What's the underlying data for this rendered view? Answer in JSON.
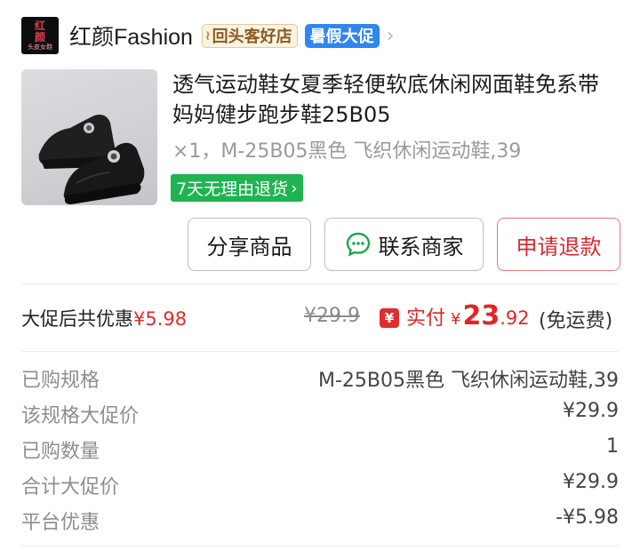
{
  "shop": {
    "logo_line1": "红",
    "logo_line2": "颜",
    "logo_line3": "头皮女鞋",
    "name": "红颜Fashion",
    "badge_return": "回头客好店",
    "badge_summer": "暑假大促"
  },
  "product": {
    "title": "透气运动鞋女夏季轻便软底休闲网面鞋免系带妈妈健步跑步鞋25B05",
    "spec": "×1，M-25B05黑色 飞织休闲运动鞋,39",
    "returns_badge": "7天无理由退货"
  },
  "actions": {
    "share": "分享商品",
    "contact": "联系商家",
    "refund": "申请退款"
  },
  "price": {
    "promo_label": "大促后共优惠",
    "promo_value": "¥5.98",
    "original": "¥29.9",
    "paid_label": "实付",
    "paid_currency": "¥",
    "paid_int": "23",
    "paid_dec": ".92",
    "shipping": "(免运费)"
  },
  "details": [
    {
      "label": "已购规格",
      "value": "M-25B05黑色 飞织休闲运动鞋,39"
    },
    {
      "label": "该规格大促价",
      "value": "¥29.9"
    },
    {
      "label": "已购数量",
      "value": "1"
    },
    {
      "label": "合计大促价",
      "value": "¥29.9"
    },
    {
      "label": "平台优惠",
      "value": "-¥5.98"
    }
  ],
  "colors": {
    "accent_red": "#e02626",
    "refund_red": "#d8292f",
    "green_badge": "#20b352",
    "blue_badge": "#2f86f0"
  },
  "icons": {
    "chat": "chat-bubble-icon",
    "chevron": "chevron-right-icon",
    "yuan": "yuan-coupon-icon"
  }
}
